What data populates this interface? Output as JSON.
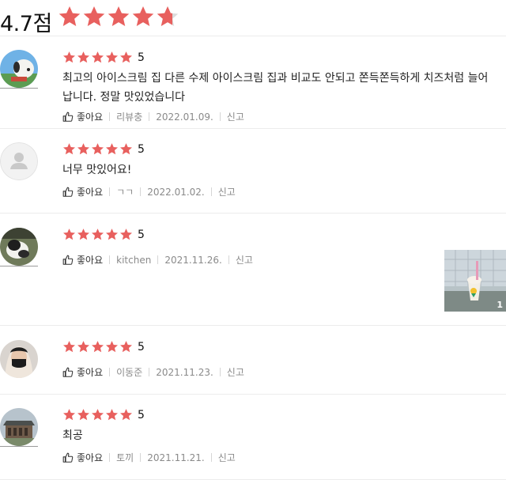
{
  "summary": {
    "score": "4.7점",
    "rating": 4.7,
    "star_color": "#e8605e",
    "star_empty_color": "#dcdcdc"
  },
  "reviews": [
    {
      "rating": "5",
      "text": "최고의 아이스크림 집 다른 수제 아이스크림 집과 비교도 안되고 쫀득쫀득하게 치즈처럼 늘어납니다. 정말 맛있었습니다",
      "like_label": "좋아요",
      "author": "리뷰충",
      "date": "2022.01.09.",
      "report_label": "신고",
      "avatar": "snoopy-avatar"
    },
    {
      "rating": "5",
      "text": "너무 맛있어요!",
      "like_label": "좋아요",
      "author": "ㄱㄱ",
      "date": "2022.01.02.",
      "report_label": "신고",
      "avatar": "default-person-avatar"
    },
    {
      "rating": "5",
      "text": "",
      "like_label": "좋아요",
      "author": "kitchen",
      "date": "2021.11.26.",
      "report_label": "신고",
      "avatar": "cat-avatar",
      "photo_count": "1"
    },
    {
      "rating": "5",
      "text": "",
      "like_label": "좋아요",
      "author": "이동준",
      "date": "2021.11.23.",
      "report_label": "신고",
      "avatar": "masked-person-avatar"
    },
    {
      "rating": "5",
      "text": "최공",
      "like_label": "좋아요",
      "author": "토끼",
      "date": "2021.11.21.",
      "report_label": "신고",
      "avatar": "building-avatar"
    }
  ]
}
